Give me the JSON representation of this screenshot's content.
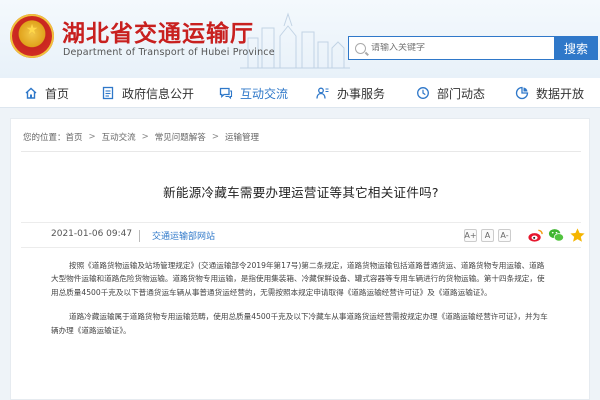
{
  "site": {
    "title": "湖北省交通运输厅",
    "subtitle": "Department of Transport of Hubei Province"
  },
  "search": {
    "placeholder": "请输入关键字",
    "button_label": "搜索"
  },
  "nav": {
    "items": [
      {
        "label": "首页",
        "icon": "home-icon"
      },
      {
        "label": "政府信息公开",
        "icon": "document-icon"
      },
      {
        "label": "互动交流",
        "icon": "chat-icon",
        "active": true
      },
      {
        "label": "办事服务",
        "icon": "service-icon"
      },
      {
        "label": "部门动态",
        "icon": "news-icon"
      },
      {
        "label": "数据开放",
        "icon": "data-icon"
      }
    ],
    "active_color": "#2f78c9"
  },
  "breadcrumb": {
    "prefix": "您的位置：",
    "items": [
      "首页",
      "互动交流",
      "常见问题解答",
      "运输管理"
    ]
  },
  "article": {
    "title": "新能源冷藏车需要办理运营证等其它相关证件吗?",
    "date": "2021-01-06 09:47",
    "source": "交通运输部网站",
    "font_controls": [
      "A+",
      "A",
      "A-"
    ],
    "share_icons": [
      "weibo-icon",
      "wechat-icon",
      "favorite-icon"
    ],
    "paragraphs": [
      "按照《道路货物运输及站场管理规定》(交通运输部令2019年第17号)第二条规定，道路货物运输包括道路普通货运、道路货物专用运输、道路大型物件运输和道路危险货物运输。道路货物专用运输，是指使用集装箱、冷藏保鲜设备、罐式容器等专用车辆进行的货物运输。第十四条规定，使用总质量4500千克及以下普通货运车辆从事普通货运经营的，无需按照本规定申请取得《道路运输经营许可证》及《道路运输证》。",
      "道路冷藏运输属于道路货物专用运输范畴，使用总质量4500千克及以下冷藏车从事道路货运经营需按规定办理《道路运输经营许可证》，并为车辆办理《道路运输证》。"
    ]
  },
  "colors": {
    "brand_red": "#c8201f",
    "accent_blue": "#2f78c9"
  }
}
